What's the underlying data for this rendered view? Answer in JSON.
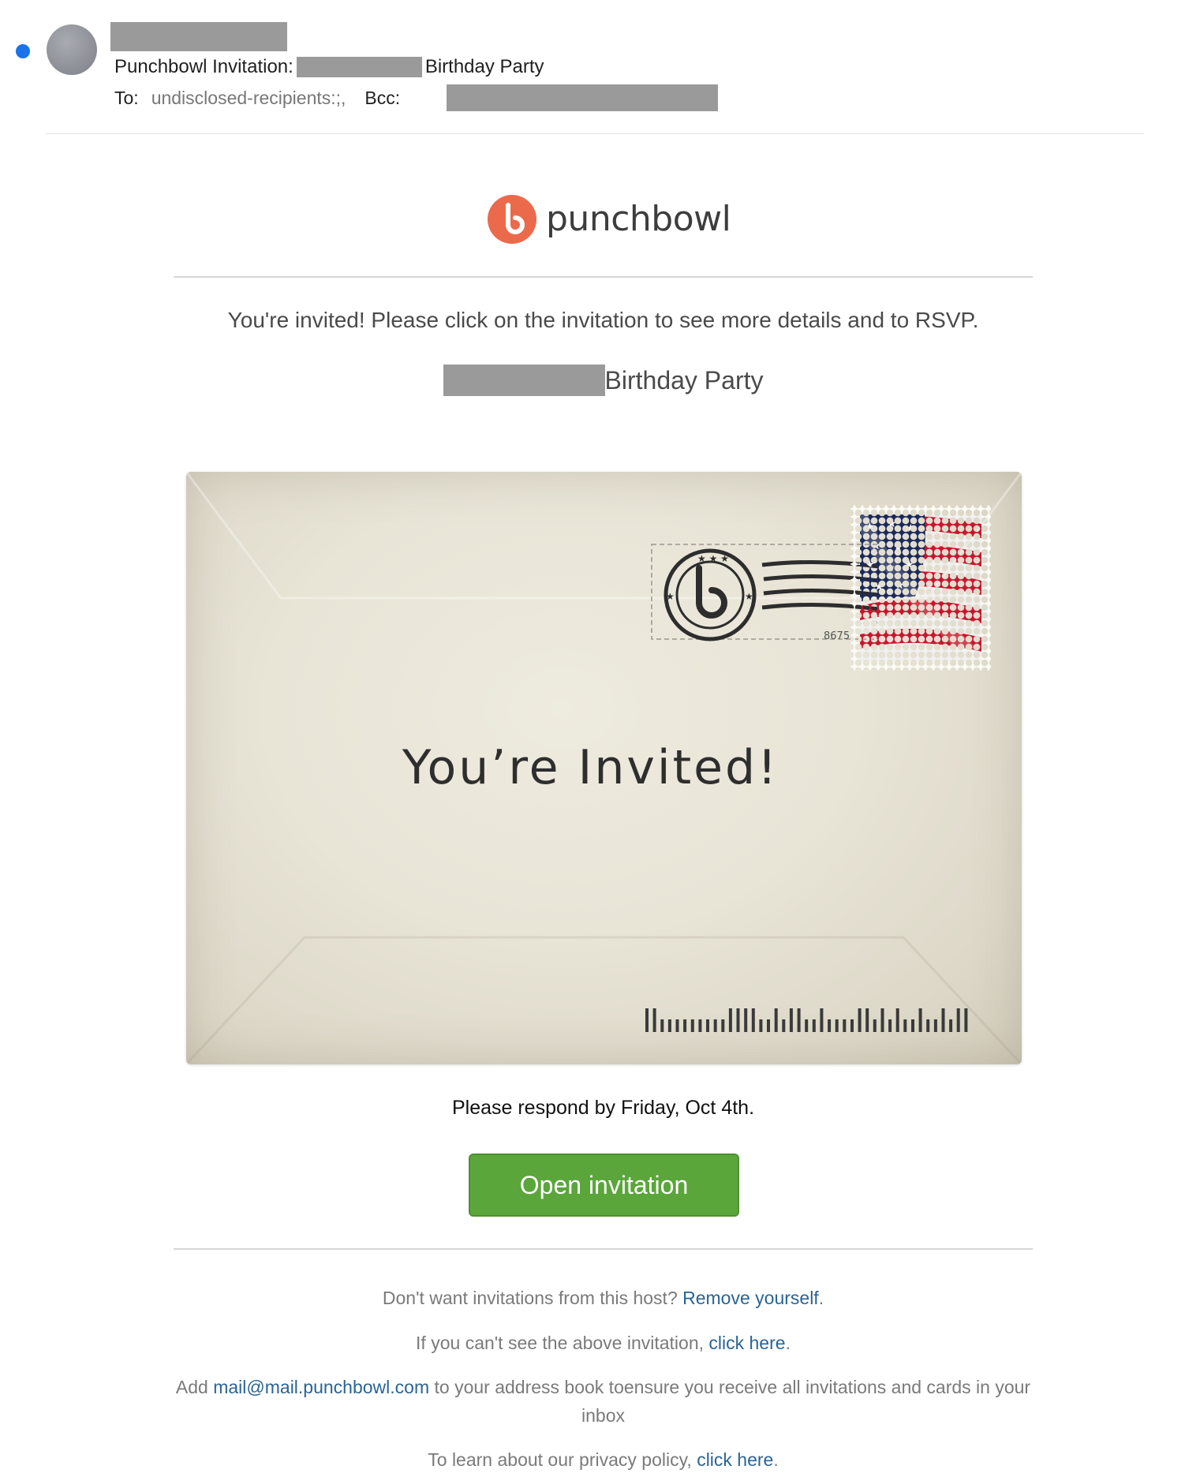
{
  "mail": {
    "subject_prefix": "Punchbowl Invitation:",
    "subject_suffix": "Birthday Party",
    "to_label": "To:",
    "to_value": "undisclosed-recipients:;,",
    "bcc_label": "Bcc:"
  },
  "brand": {
    "name": "punchbowl",
    "accent_color": "#ec6a4c"
  },
  "body": {
    "intro": "You're invited! Please click on the invitation to see more details and to RSVP.",
    "event_title_suffix": "Birthday Party",
    "envelope_text": "You’re Invited!",
    "postmark_number": "8675",
    "respond_by": "Please respond by Friday, Oct 4th.",
    "open_button": "Open invitation",
    "button_color": "#5aa63a"
  },
  "footer": {
    "unsubscribe_text": "Don't want invitations from this host?",
    "unsubscribe_link": "Remove yourself",
    "cant_see_text": "If you can't see the above invitation,",
    "cant_see_link": "click here",
    "add_prefix": "Add",
    "add_email": "mail@mail.punchbowl.com",
    "add_suffix": "to your address book toensure you receive all invitations and cards in your inbox",
    "privacy_text": "To learn about our privacy policy,",
    "privacy_link": "click here",
    "period": "."
  },
  "icons": {
    "unread": "unread-dot-icon",
    "avatar": "sender-avatar",
    "logo": "punchbowl-logo-icon",
    "stamp": "flag-stamp-icon",
    "postmark": "postmark-icon",
    "barcode": "barcode-icon"
  }
}
